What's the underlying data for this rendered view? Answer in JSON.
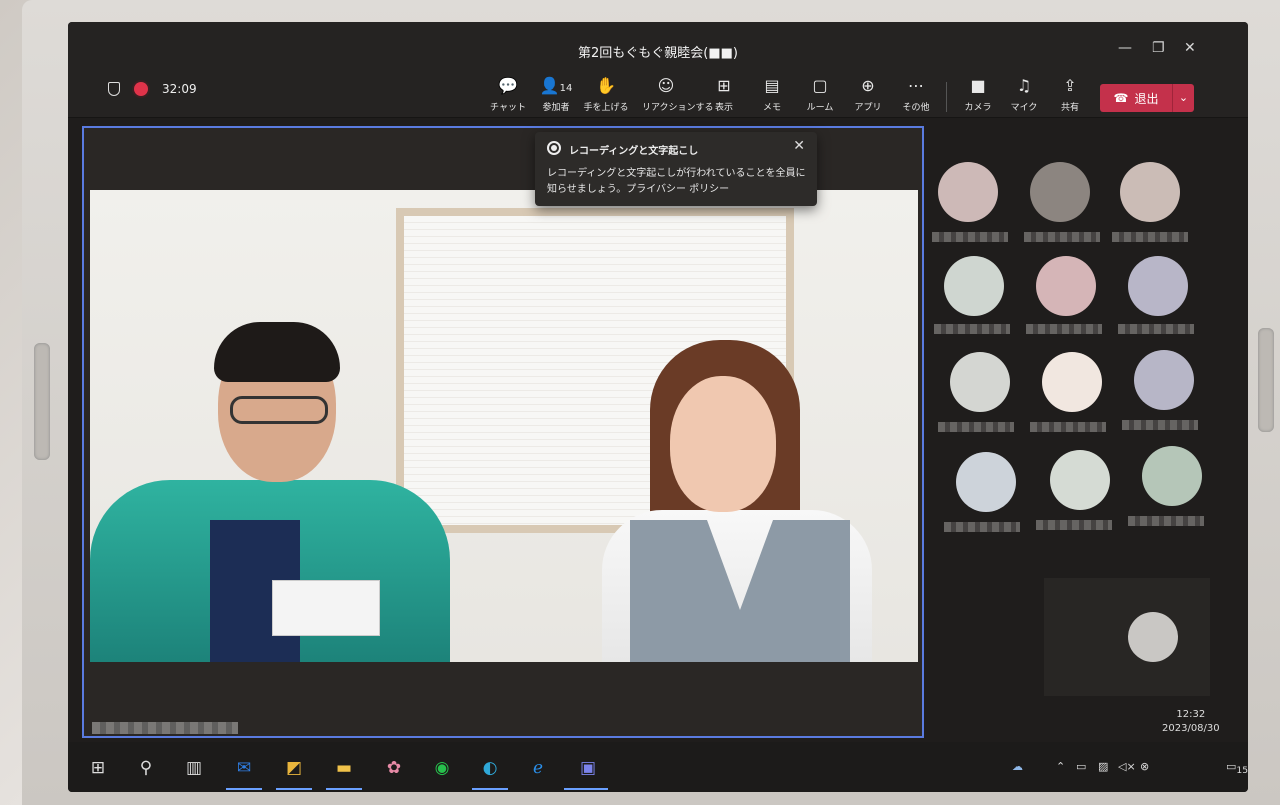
{
  "window": {
    "title": "第2回もぐもぐ親睦会(■■)",
    "minimize_icon": "minimize-icon",
    "maximize_icon": "maximize-icon",
    "close_icon": "close-icon"
  },
  "meeting": {
    "elapsed": "32:09",
    "recording": true
  },
  "toolbar": {
    "items": [
      {
        "label": "チャット",
        "icon": "chat-icon",
        "glyph": "☺"
      },
      {
        "label": "参加者",
        "icon": "people-icon",
        "glyph": "👤",
        "badge": "14"
      },
      {
        "label": "手を上げる",
        "icon": "raise-hand-icon",
        "glyph": "✋"
      },
      {
        "label": "リアクションする",
        "icon": "reaction-icon",
        "glyph": "☺"
      },
      {
        "label": "表示",
        "icon": "view-icon",
        "glyph": "⊞"
      },
      {
        "label": "メモ",
        "icon": "notes-icon",
        "glyph": "▤"
      },
      {
        "label": "ルーム",
        "icon": "rooms-icon",
        "glyph": "▢"
      },
      {
        "label": "アプリ",
        "icon": "apps-icon",
        "glyph": "⊕"
      },
      {
        "label": "その他",
        "icon": "more-icon",
        "glyph": "⋯"
      },
      {
        "label": "カメラ",
        "icon": "camera-icon",
        "glyph": "■"
      },
      {
        "label": "マイク",
        "icon": "mic-off-icon",
        "glyph": "♫"
      },
      {
        "label": "共有",
        "icon": "share-icon",
        "glyph": "⇪"
      }
    ],
    "leave_label": "退出"
  },
  "notification": {
    "title": "レコーディングと文字起こし",
    "body": "レコーディングと文字起こしが行われていることを全員に知らせましょう。プライバシー ポリシー"
  },
  "taskbar": {
    "clock_time": "12:32",
    "clock_date": "2023/08/30",
    "notification_count": "15",
    "colors": {
      "accent": "#6aa0ff",
      "leave": "#c4314b",
      "recording": "#e0334a",
      "stage_border": "#5a7be0"
    }
  }
}
